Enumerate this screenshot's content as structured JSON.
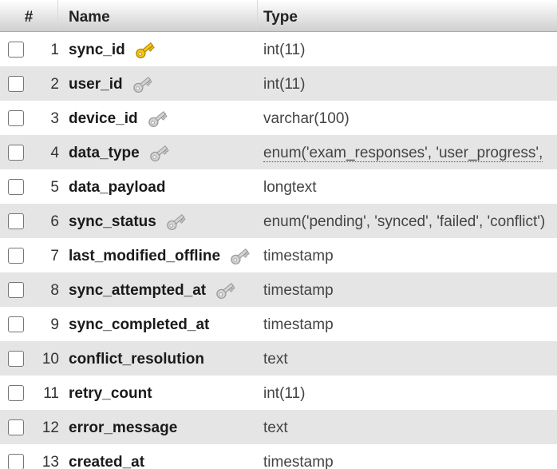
{
  "header": {
    "num": "#",
    "name": "Name",
    "type": "Type"
  },
  "colors": {
    "primary_key": "#e6b800",
    "index_key": "#b0b0b0",
    "row_alt": "#e5e5e5"
  },
  "rows": [
    {
      "num": "1",
      "name": "sync_id",
      "type": "int(11)",
      "key": "primary-key-icon"
    },
    {
      "num": "2",
      "name": "user_id",
      "type": "int(11)",
      "key": "index-key-icon"
    },
    {
      "num": "3",
      "name": "device_id",
      "type": "varchar(100)",
      "key": "index-key-icon"
    },
    {
      "num": "4",
      "name": "data_type",
      "type": "enum('exam_responses', 'user_progress',",
      "key": "index-key-icon"
    },
    {
      "num": "5",
      "name": "data_payload",
      "type": "longtext",
      "key": ""
    },
    {
      "num": "6",
      "name": "sync_status",
      "type": "enum('pending', 'synced', 'failed', 'conflict')",
      "key": "index-key-icon"
    },
    {
      "num": "7",
      "name": "last_modified_offline",
      "type": "timestamp",
      "key": "index-key-icon"
    },
    {
      "num": "8",
      "name": "sync_attempted_at",
      "type": "timestamp",
      "key": "index-key-icon"
    },
    {
      "num": "9",
      "name": "sync_completed_at",
      "type": "timestamp",
      "key": ""
    },
    {
      "num": "10",
      "name": "conflict_resolution",
      "type": "text",
      "key": ""
    },
    {
      "num": "11",
      "name": "retry_count",
      "type": "int(11)",
      "key": ""
    },
    {
      "num": "12",
      "name": "error_message",
      "type": "text",
      "key": ""
    },
    {
      "num": "13",
      "name": "created_at",
      "type": "timestamp",
      "key": ""
    }
  ]
}
